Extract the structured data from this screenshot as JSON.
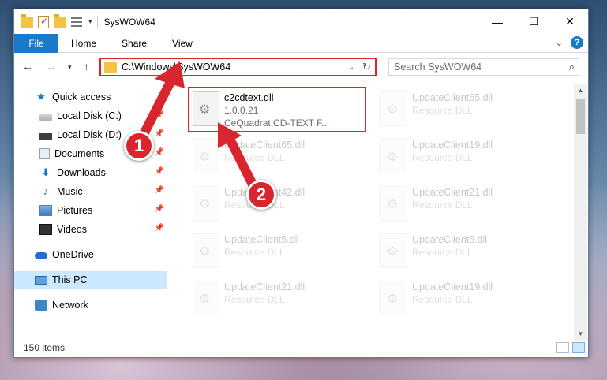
{
  "window": {
    "title": "SysWOW64",
    "controls": {
      "minimize": "—",
      "maximize": "☐",
      "close": "✕"
    }
  },
  "ribbon": {
    "tabs": [
      "File",
      "Home",
      "Share",
      "View"
    ],
    "help": "?"
  },
  "address": {
    "path": "C:\\Windows\\SysWOW64",
    "search_placeholder": "Search SysWOW64"
  },
  "navpane": {
    "items": [
      {
        "label": "Quick access",
        "icon": "star-icon",
        "pinned": false
      },
      {
        "label": "Local Disk (C:)",
        "icon": "drive-icon",
        "pinned": true
      },
      {
        "label": "Local Disk (D:)",
        "icon": "drive-icon",
        "pinned": true
      },
      {
        "label": "Documents",
        "icon": "documents-icon",
        "pinned": true
      },
      {
        "label": "Downloads",
        "icon": "downloads-icon",
        "pinned": true
      },
      {
        "label": "Music",
        "icon": "music-icon",
        "pinned": true
      },
      {
        "label": "Pictures",
        "icon": "pictures-icon",
        "pinned": true
      },
      {
        "label": "Videos",
        "icon": "videos-icon",
        "pinned": true
      },
      {
        "label": "OneDrive",
        "icon": "onedrive-icon",
        "pinned": false
      },
      {
        "label": "This PC",
        "icon": "this-pc-icon",
        "pinned": false,
        "selected": true
      },
      {
        "label": "Network",
        "icon": "network-icon",
        "pinned": false
      }
    ]
  },
  "files": {
    "highlighted": {
      "name": "c2cdtext.dll",
      "version": "1.0.0.21",
      "description": "CeQuadrat CD-TEXT F..."
    },
    "background": [
      {
        "name": "UpdateClient65.dll",
        "type": "Resource DLL"
      },
      {
        "name": "UpdateClient65.dll",
        "type": "Resource DLL"
      },
      {
        "name": "UpdateClient19.dll",
        "type": "Resource DLL"
      },
      {
        "name": "UpdateClient42.dll",
        "type": "Resource DLL"
      },
      {
        "name": "UpdateClient21.dll",
        "type": "Resource DLL"
      },
      {
        "name": "UpdateClient5.dll",
        "type": "Resource DLL"
      },
      {
        "name": "UpdateClient5.dll",
        "type": "Resource DLL"
      },
      {
        "name": "UpdateClient21.dll",
        "type": "Resource DLL"
      },
      {
        "name": "UpdateClient19.dll",
        "type": "Resource DLL"
      }
    ]
  },
  "status": {
    "item_count": "150 items"
  },
  "annotations": {
    "badge1": "1",
    "badge2": "2",
    "color": "#d9262e"
  }
}
